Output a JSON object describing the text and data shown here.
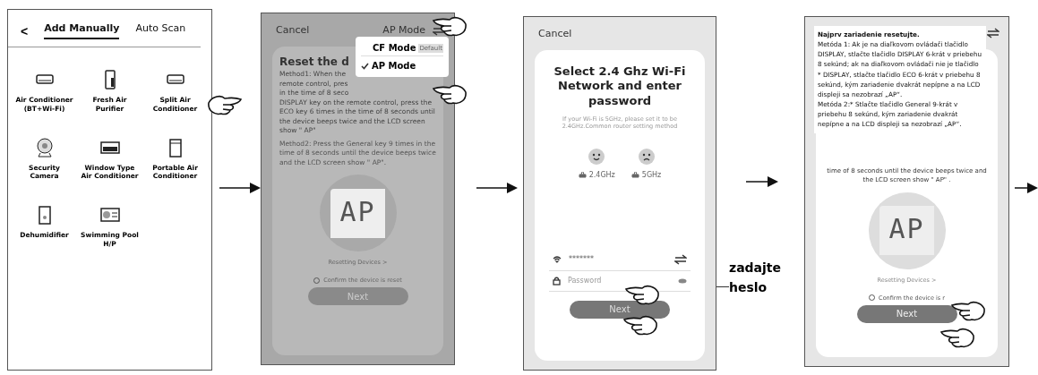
{
  "step1": {
    "back": "<",
    "tabs": [
      {
        "label": "Add Manually",
        "selected": true
      },
      {
        "label": "Auto Scan",
        "selected": false
      }
    ],
    "devices": [
      {
        "kind": "wall-ac",
        "label": "Air Conditioner (BT+Wi-Fi)"
      },
      {
        "kind": "purifier",
        "label": "Fresh Air Purifier"
      },
      {
        "kind": "wall-ac",
        "label": "Split Air Conditioner"
      },
      {
        "kind": "camera",
        "label": "Security Camera"
      },
      {
        "kind": "window-ac",
        "label": "Window Type Air Conditioner"
      },
      {
        "kind": "portable-ac",
        "label": "Portable Air Conditioner"
      },
      {
        "kind": "dehumidifier",
        "label": "Dehumidifier"
      },
      {
        "kind": "pool",
        "label": "Swimming Pool H/P"
      }
    ]
  },
  "step2": {
    "cancel": "Cancel",
    "mode": "AP Mode",
    "heading": "Reset the d",
    "method1_lines": [
      "Method1: When the",
      "remote control, pres",
      "in the time of 8 seco",
      "DISPLAY key on the remote control, press the",
      "ECO key 6 times in the time of 8 seconds until",
      "the device beeps twice and the LCD screen",
      "show \" AP\""
    ],
    "method2": "Method2: Press the General key 9 times in the time of 8 seconds until the device beeps twice and the LCD screen show \" AP\".",
    "menu": [
      {
        "label": "CF Mode",
        "badge": "Default",
        "selected": false
      },
      {
        "label": "AP Mode",
        "selected": true
      }
    ],
    "lcd": "AP",
    "link": "Resetting Devices >",
    "confirm": "Confirm the device is reset",
    "next": "Next"
  },
  "step3": {
    "cancel": "Cancel",
    "title": "Select 2.4 Ghz Wi-Fi Network and enter password",
    "hint": "If your Wi-Fi is 5GHz, please set it to be 2.4GHz.Common router setting method",
    "bands": [
      {
        "label": "2.4GHz",
        "kind": "happy"
      },
      {
        "label": "5GHz",
        "kind": "sad"
      }
    ],
    "wifi_value": "*******",
    "password_placeholder": "Password",
    "next": "Next"
  },
  "callout": "zadajte heslo",
  "step4": {
    "note_title": "Najprv zariadenie resetujte.",
    "note": "Metóda 1: Ak je na diaľkovom ovládači tlačidlo DISPLAY, stlačte tlačidlo DISPLAY 6-krát v priebehu 8 sekúnd; ak na diaľkovom ovládači nie je tlačidlo * DISPLAY, stlačte tlačidlo ECO 6-krát v priebehu 8 sekúnd, kým zariadenie dvakrát nepípne a na LCD displeji sa nezobrazí „AP“.",
    "note2": "Metóda 2:* Stlačte tlačidlo General 9-krát v priebehu 8 sekúnd, kým zariadenie dvakrát nepípne a na LCD displeji sa nezobrazí „AP“.",
    "english": "time of 8 seconds until the device beeps twice and the LCD screen show \" AP\" .",
    "lcd": "AP",
    "link": "Resetting Devices >",
    "confirm": "Confirm the device is r",
    "next": "Next"
  }
}
